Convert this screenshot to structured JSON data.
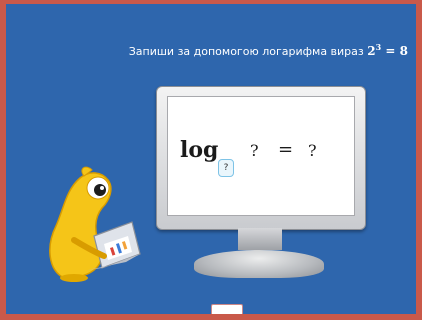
{
  "task": {
    "prompt": "Запиши за допомогою логарифма вираз",
    "expression_base": "2",
    "expression_exponent": "3",
    "expression_eq": "=",
    "expression_value": "8"
  },
  "formula": {
    "log_label": "log",
    "base_placeholder": "?",
    "argument": "?",
    "equals": "=",
    "result": "?"
  },
  "check_button": {
    "label": ""
  },
  "colors": {
    "background": "#2e66ad",
    "border": "#c9594a",
    "mascot": "#f5c518",
    "laptop": "#dfe3ea"
  },
  "icons": {
    "mascot": "yellow-creature-mascot",
    "laptop": "laptop-icon"
  }
}
